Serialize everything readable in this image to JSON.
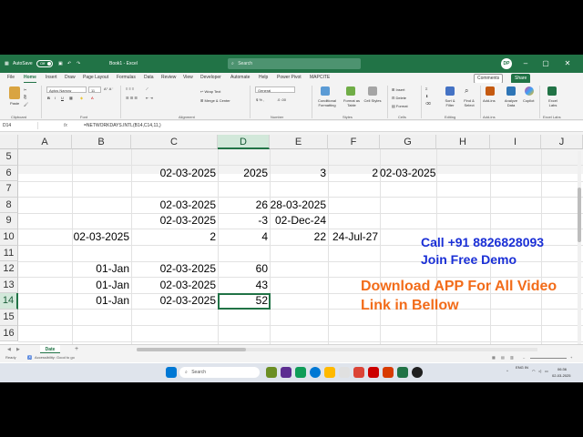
{
  "colors": {
    "excel_green": "#217346",
    "overlay_blue": "#1a2fd6",
    "overlay_orange": "#f26c1a"
  },
  "titlebar": {
    "autosave": "AutoSave",
    "toggle": "Off",
    "filename": "Book1 - Excel",
    "search": "Search",
    "user_initials": "DP"
  },
  "menu": {
    "items": [
      "File",
      "Home",
      "Insert",
      "Draw",
      "Page Layout",
      "Formulas",
      "Data",
      "Review",
      "View",
      "Developer",
      "Automate",
      "Help",
      "Power Pivot",
      "MAPCITE"
    ],
    "comments": "Comments",
    "share": "Share"
  },
  "ribbon": {
    "paste": "Paste",
    "font_name": "Aptos Narrow",
    "font_size": "11",
    "wrap_text": "Wrap Text",
    "merge_center": "Merge & Center",
    "number_format": "General",
    "conditional_formatting": "Conditional Formatting",
    "format_as_table": "Format as Table",
    "cell_styles": "Cell Styles",
    "insert": "Insert",
    "delete": "Delete",
    "format": "Format",
    "sort_filter": "Sort & Filter",
    "find_select": "Find & Select",
    "addins": "Add-ins",
    "analyze_data": "Analyze Data",
    "copilot": "Copilot",
    "excel_labs": "Excel Labs",
    "groups": [
      "Clipboard",
      "Font",
      "Alignment",
      "Number",
      "Styles",
      "Cells",
      "Editing",
      "Add-ins",
      "Excel Labs"
    ]
  },
  "formula_bar": {
    "name_box": "D14",
    "fx": "fx",
    "formula": "=NETWORKDAYS.INTL(B14,C14,11,)"
  },
  "grid": {
    "columns": [
      "A",
      "B",
      "C",
      "D",
      "E",
      "F",
      "G",
      "H",
      "I",
      "J"
    ],
    "rows": [
      "5",
      "6",
      "7",
      "8",
      "9",
      "10",
      "11",
      "12",
      "13",
      "14",
      "15",
      "16"
    ],
    "selected_cell": "D14",
    "cells": {
      "C6": "02-03-2025",
      "D6": "2025",
      "E6": "3",
      "F6": "2",
      "G6": "02-03-2025",
      "C8": "02-03-2025",
      "D8": "26",
      "E8": "28-03-2025",
      "C9": "02-03-2025",
      "D9": "-3",
      "E9": "02-Dec-24",
      "B10": "02-03-2025",
      "C10": "2",
      "D10": "4",
      "E10": "22",
      "F10": "24-Jul-27",
      "B12": "01-Jan",
      "C12": "02-03-2025",
      "D12": "60",
      "B13": "01-Jan",
      "C13": "02-03-2025",
      "D13": "43",
      "B14": "01-Jan",
      "C14": "02-03-2025",
      "D14": "52"
    }
  },
  "overlay": {
    "call": "Call +91 8826828093",
    "demo": "Join Free Demo",
    "download": "Download APP For All Video",
    "link": "Link in Bellow"
  },
  "sheet_tabs": {
    "active": "Date"
  },
  "status": {
    "ready": "Ready",
    "accessibility": "Accessibility: Good to go"
  },
  "taskbar": {
    "search": "Search",
    "lang": "ENG IN",
    "time": "06:36",
    "date": "02-03-2025"
  }
}
